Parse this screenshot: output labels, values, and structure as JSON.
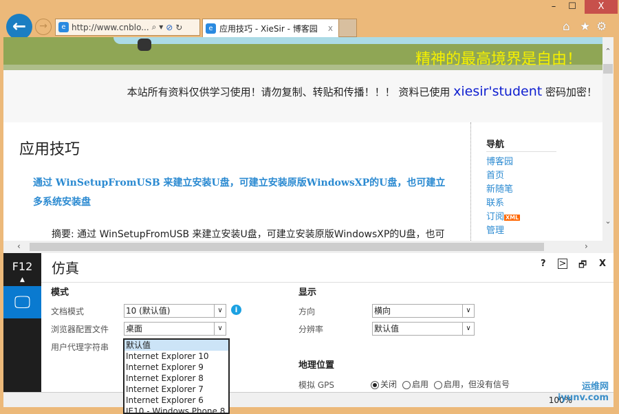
{
  "window": {
    "minimize": "–",
    "maximize": "☐",
    "close": "X"
  },
  "nav": {
    "back": "←",
    "forward": "→"
  },
  "address": {
    "url": "http://www.cnblo...",
    "search": "⌕ ▾",
    "stop": "⊘",
    "refresh": "↻"
  },
  "tab": {
    "title": "应用技巧 - XieSir - 博客园",
    "close": "x",
    "icon": "e"
  },
  "tools": {
    "home": "⌂",
    "favorites": "★",
    "settings": "⚙"
  },
  "page": {
    "motto": "精神的最高境界是自由！",
    "notice_pre": "本站所有资料仅供学习使用！请勿复制、转贴和传播！！！ 资料已使用 ",
    "notice_brand": "xiesir'student",
    "notice_post": " 密码加密！",
    "heading": "应用技巧",
    "post_title": "通过 WinSetupFromUSB 来建立安装U盘，可建立安装原版WindowsXP的U盘，也可建立多系统安装盘",
    "summary": "摘要: 通过 WinSetupFromUSB 来建立安装U盘，可建立安装原版WindowsXP的U盘，也可",
    "sidebar": {
      "title": "导航",
      "items": [
        "博客园",
        "首页",
        "新随笔",
        "联系",
        "订阅",
        "管理"
      ],
      "xml_badge": "XML"
    }
  },
  "devtools": {
    "f12": "F12",
    "title": "仿真",
    "help": "?",
    "console": ">",
    "dock": "🗗",
    "close": "X",
    "mode": {
      "heading": "模式",
      "doc_mode_label": "文档模式",
      "doc_mode": "10 (默认值)",
      "profile_label": "浏览器配置文件",
      "profile": "桌面",
      "ua_label": "用户代理字符串",
      "ua_options": [
        "默认值",
        "Internet Explorer 10",
        "Internet Explorer 9",
        "Internet Explorer 8",
        "Internet Explorer 7",
        "Internet Explorer 6",
        "IE10 - Windows Phone 8"
      ]
    },
    "display": {
      "heading": "显示",
      "orientation_label": "方向",
      "orientation": "横向",
      "resolution_label": "分辨率",
      "resolution": "默认值"
    },
    "geo": {
      "heading": "地理位置",
      "gps_label": "模拟 GPS",
      "options": [
        "关闭",
        "启用",
        "启用，但没有信号"
      ]
    }
  },
  "status": {
    "zoom": "100%"
  },
  "watermark": "运维网 iyunv.com"
}
